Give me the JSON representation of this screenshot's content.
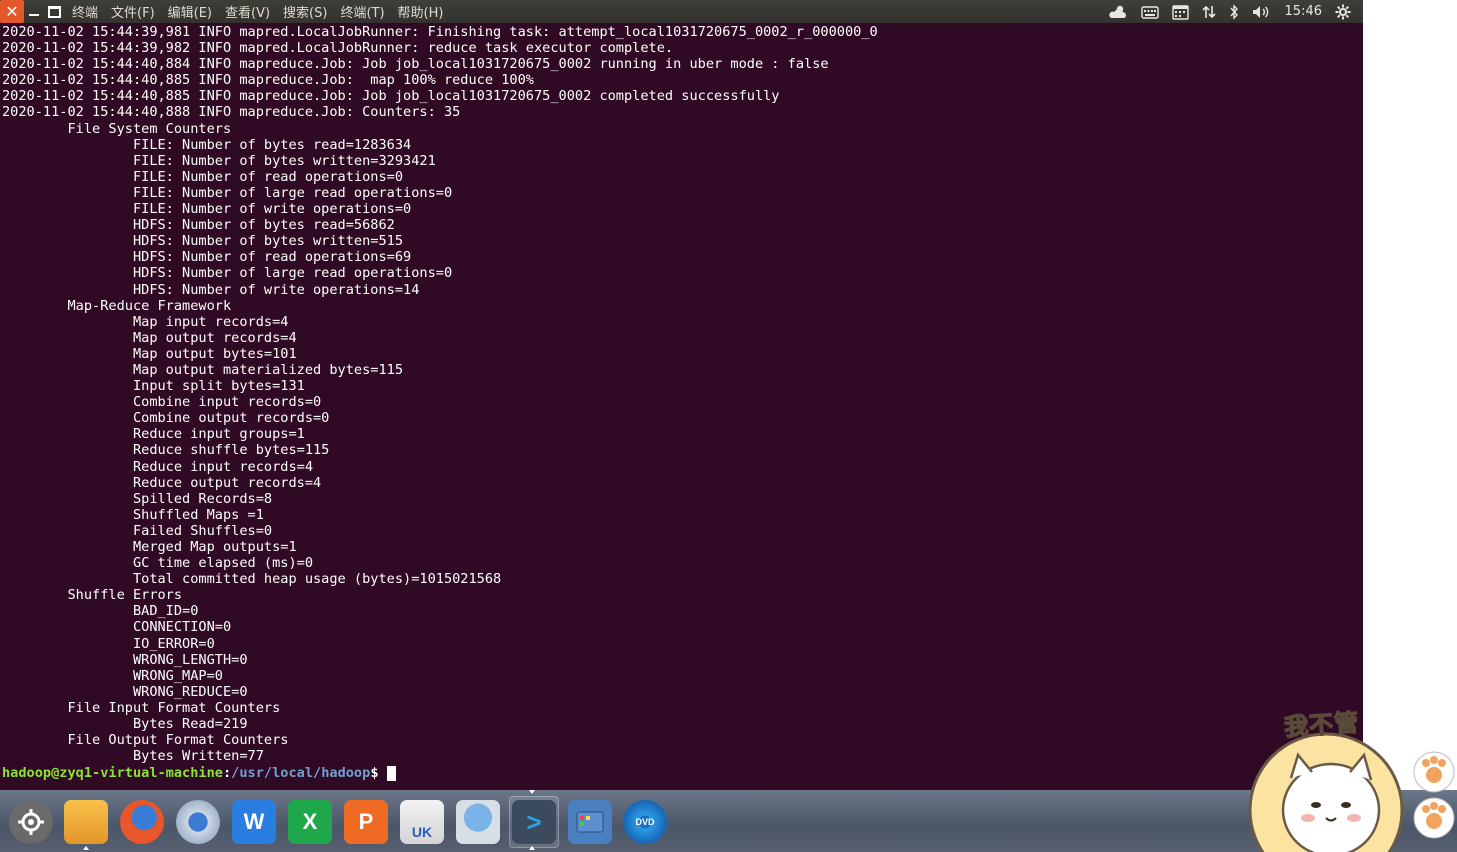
{
  "topbar": {
    "close_glyph": "✕",
    "menu": [
      "终端",
      "文件(F)",
      "编辑(E)",
      "查看(V)",
      "搜索(S)",
      "终端(T)",
      "帮助(H)"
    ],
    "indicators": {
      "weather_icon": "cloud-sun-icon",
      "keyboard_icon": "keyboard-icon",
      "calendar_icon": "calendar-icon",
      "network_icon": "network-updown-icon",
      "bluetooth_icon": "bluetooth-icon",
      "volume_icon": "volume-icon",
      "clock": "15:46",
      "settings_icon": "gear-icon"
    }
  },
  "terminal": {
    "lines": [
      "2020-11-02 15:44:39,981 INFO mapred.LocalJobRunner: Finishing task: attempt_local1031720675_0002_r_000000_0",
      "2020-11-02 15:44:39,982 INFO mapred.LocalJobRunner: reduce task executor complete.",
      "2020-11-02 15:44:40,884 INFO mapreduce.Job: Job job_local1031720675_0002 running in uber mode : false",
      "2020-11-02 15:44:40,885 INFO mapreduce.Job:  map 100% reduce 100%",
      "2020-11-02 15:44:40,885 INFO mapreduce.Job: Job job_local1031720675_0002 completed successfully",
      "2020-11-02 15:44:40,888 INFO mapreduce.Job: Counters: 35",
      "        File System Counters",
      "                FILE: Number of bytes read=1283634",
      "                FILE: Number of bytes written=3293421",
      "                FILE: Number of read operations=0",
      "                FILE: Number of large read operations=0",
      "                FILE: Number of write operations=0",
      "                HDFS: Number of bytes read=56862",
      "                HDFS: Number of bytes written=515",
      "                HDFS: Number of read operations=69",
      "                HDFS: Number of large read operations=0",
      "                HDFS: Number of write operations=14",
      "        Map-Reduce Framework",
      "                Map input records=4",
      "                Map output records=4",
      "                Map output bytes=101",
      "                Map output materialized bytes=115",
      "                Input split bytes=131",
      "                Combine input records=0",
      "                Combine output records=0",
      "                Reduce input groups=1",
      "                Reduce shuffle bytes=115",
      "                Reduce input records=4",
      "                Reduce output records=4",
      "                Spilled Records=8",
      "                Shuffled Maps =1",
      "                Failed Shuffles=0",
      "                Merged Map outputs=1",
      "                GC time elapsed (ms)=0",
      "                Total committed heap usage (bytes)=1015021568",
      "        Shuffle Errors",
      "                BAD_ID=0",
      "                CONNECTION=0",
      "                IO_ERROR=0",
      "                WRONG_LENGTH=0",
      "                WRONG_MAP=0",
      "                WRONG_REDUCE=0",
      "        File Input Format Counters",
      "                Bytes Read=219",
      "        File Output Format Counters",
      "                Bytes Written=77"
    ],
    "prompt": {
      "user_host": "hadoop@zyq1-virtual-machine",
      "sep": ":",
      "path": "/usr/local/hadoop",
      "symbol": "$"
    },
    "colors": {
      "background": "#300a24",
      "text": "#ffffff",
      "prompt_user": "#8ae234",
      "prompt_path": "#729fcf"
    }
  },
  "dock": {
    "items": [
      {
        "name": "system-settings-icon",
        "label": ""
      },
      {
        "name": "files-icon",
        "label": ""
      },
      {
        "name": "firefox-icon",
        "label": ""
      },
      {
        "name": "chromium-icon",
        "label": ""
      },
      {
        "name": "wps-writer-icon",
        "label": "W"
      },
      {
        "name": "wps-spreadsheets-icon",
        "label": "X"
      },
      {
        "name": "wps-presentation-icon",
        "label": "P"
      },
      {
        "name": "ubuntu-software-icon",
        "label": "UK"
      },
      {
        "name": "remmina-icon",
        "label": ""
      },
      {
        "name": "terminal-icon",
        "label": ">"
      },
      {
        "name": "workspace-switcher-icon",
        "label": ""
      },
      {
        "name": "dvd-icon",
        "label": "DVD"
      }
    ]
  },
  "sticker": {
    "text": "我不管"
  }
}
